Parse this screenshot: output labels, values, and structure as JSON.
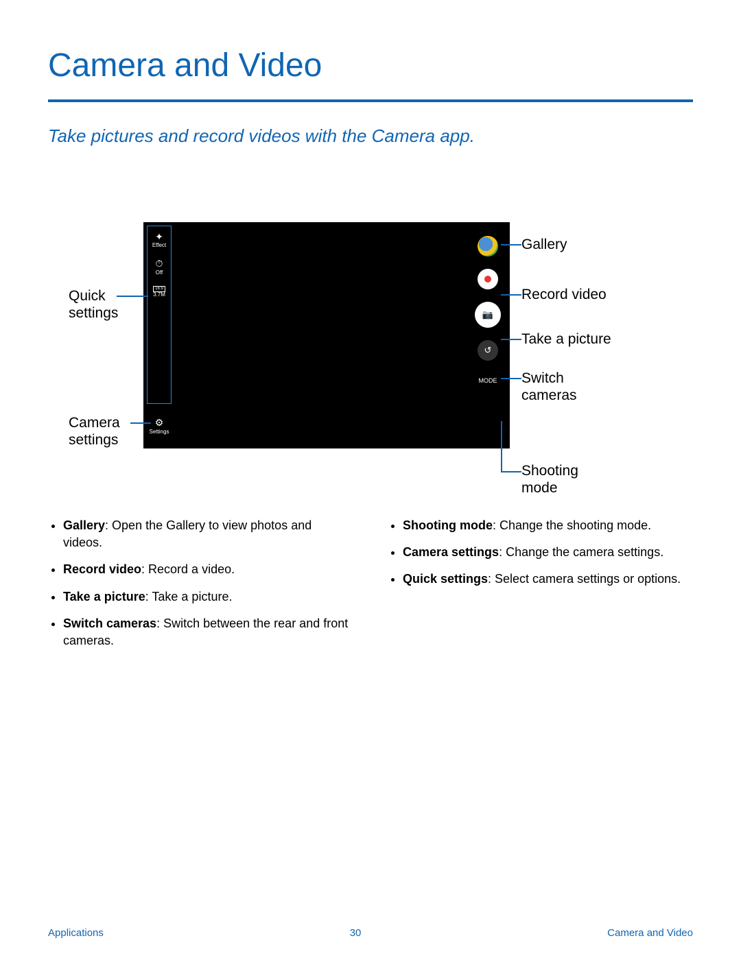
{
  "title": "Camera and Video",
  "subtitle": "Take pictures and record videos with the Camera app.",
  "camera_ui": {
    "effect_label": "Effect",
    "timer_label": "Off",
    "ratio_label": "16:9",
    "size_label": "3.7M",
    "settings_label": "Settings",
    "mode_label": "MODE"
  },
  "callouts": {
    "quick_settings": "Quick settings",
    "camera_settings": "Camera settings",
    "gallery": "Gallery",
    "record_video": "Record video",
    "take_picture": "Take a picture",
    "switch_cameras": "Switch cameras",
    "shooting_mode": "Shooting mode"
  },
  "bullets_left": [
    {
      "term": "Gallery",
      "desc": ": Open the Gallery to view photos and videos."
    },
    {
      "term": "Record video",
      "desc": ": Record a video."
    },
    {
      "term": "Take a picture",
      "desc": ": Take a picture."
    },
    {
      "term": "Switch cameras",
      "desc": ": Switch between the rear and front cameras."
    }
  ],
  "bullets_right": [
    {
      "term": "Shooting mode",
      "desc": ": Change the shooting mode."
    },
    {
      "term": "Camera settings",
      "desc": ": Change the camera settings."
    },
    {
      "term": "Quick settings",
      "desc": ": Select camera settings or options."
    }
  ],
  "footer": {
    "left": "Applications",
    "page": "30",
    "right": "Camera and Video"
  }
}
